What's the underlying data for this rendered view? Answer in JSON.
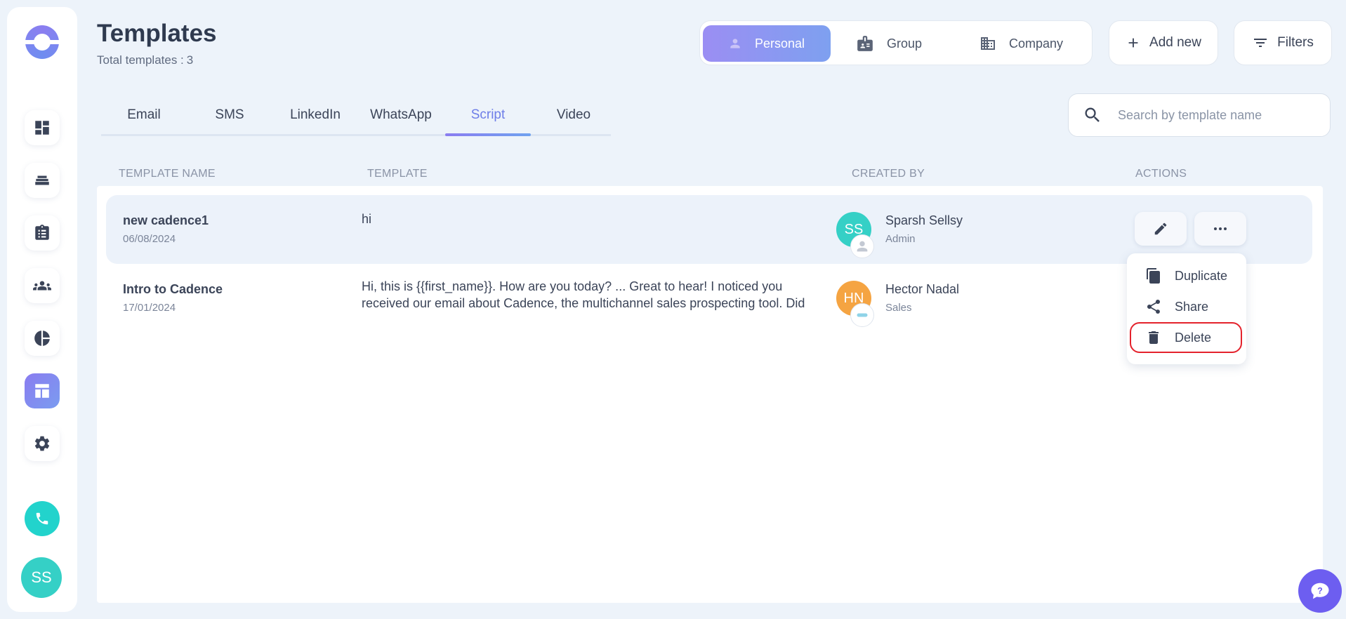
{
  "page": {
    "title": "Templates",
    "total_label": "Total templates :",
    "total_count": "3"
  },
  "scope_tabs": [
    {
      "label": "Personal",
      "icon": "person-icon",
      "active": true
    },
    {
      "label": "Group",
      "icon": "id-card-icon",
      "active": false
    },
    {
      "label": "Company",
      "icon": "building-icon",
      "active": false
    }
  ],
  "buttons": {
    "add_new": "Add new",
    "filters": "Filters"
  },
  "tabs": [
    {
      "label": "Email",
      "active": false
    },
    {
      "label": "SMS",
      "active": false
    },
    {
      "label": "LinkedIn",
      "active": false
    },
    {
      "label": "WhatsApp",
      "active": false
    },
    {
      "label": "Script",
      "active": true
    },
    {
      "label": "Video",
      "active": false
    }
  ],
  "search": {
    "placeholder": "Search by template name"
  },
  "columns": [
    "TEMPLATE NAME",
    "TEMPLATE",
    "CREATED BY",
    "ACTIONS"
  ],
  "rows": [
    {
      "name": "new cadence1",
      "date": "06/08/2024",
      "template": "hi",
      "initials": "SS",
      "user": "Sparsh Sellsy",
      "role": "Admin"
    },
    {
      "name": "Intro to Cadence",
      "date": "17/01/2024",
      "template": "Hi, this is {{first_name}}. How are you today? ... Great to hear! I noticed you received our email about Cadence, the multichannel sales prospecting tool. Did you...",
      "initials": "HN",
      "user": "Hector Nadal",
      "role": "Sales"
    }
  ],
  "menu": {
    "duplicate": "Duplicate",
    "share": "Share",
    "delete": "Delete"
  },
  "sidebar": {
    "user_initials": "SS"
  },
  "colors": {
    "accent": "#8a7cf0",
    "teal": "#35d0c6",
    "orange": "#f5a442",
    "danger": "#e4222c"
  }
}
